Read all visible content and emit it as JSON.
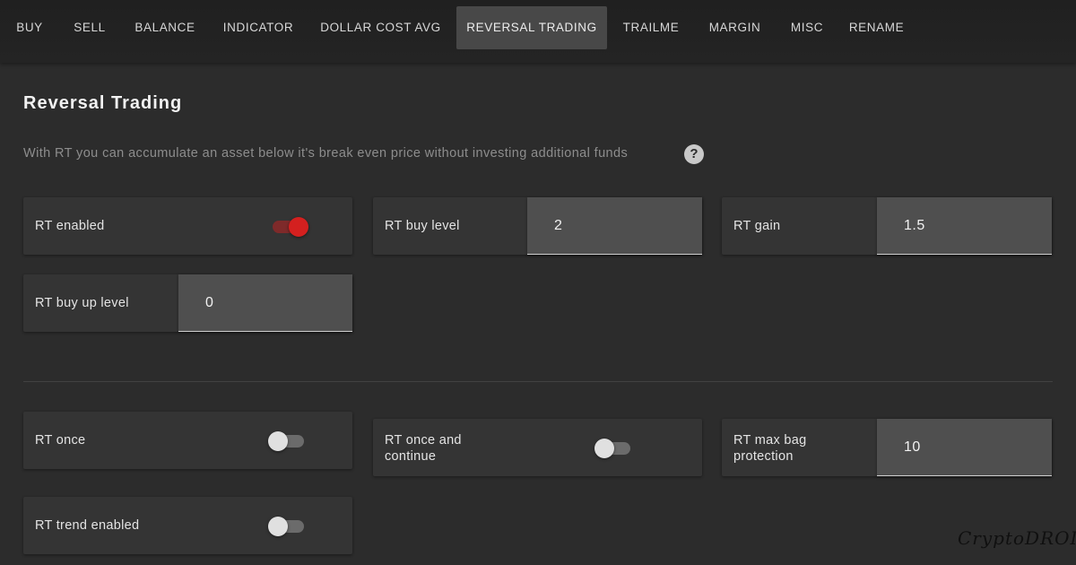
{
  "tabs": [
    "BUY",
    "SELL",
    "BALANCE",
    "INDICATOR",
    "DOLLAR COST AVG",
    "REVERSAL TRADING",
    "TRAILME",
    "MARGIN",
    "MISC",
    "RENAME"
  ],
  "active_tab": "REVERSAL TRADING",
  "page": {
    "title": "Reversal Trading",
    "subtitle": "With RT you can accumulate an asset below it's break even price without investing additional funds"
  },
  "fields": {
    "rt_enabled": {
      "label": "RT enabled",
      "on": true
    },
    "rt_buy_level": {
      "label": "RT buy level",
      "value": "2"
    },
    "rt_gain": {
      "label": "RT gain",
      "value": "1.5"
    },
    "rt_buy_up_level": {
      "label": "RT buy up level",
      "value": "0"
    },
    "rt_once": {
      "label": "RT once",
      "on": false
    },
    "rt_once_and_continue": {
      "label_line1": "RT once and",
      "label_line2": "continue",
      "on": false
    },
    "rt_max_bag_protection": {
      "label_line1": "RT max bag",
      "label_line2": "protection",
      "value": "10"
    },
    "rt_trend_enabled": {
      "label": "RT trend enabled",
      "on": false
    }
  },
  "watermark": "CryptoDROI",
  "colors": {
    "accent": "#d4201f",
    "background": "#2c2c2c",
    "card": "#343434",
    "input": "#4f4f4f"
  }
}
